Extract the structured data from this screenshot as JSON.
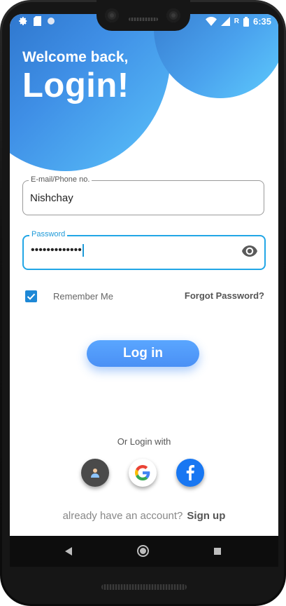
{
  "status_bar": {
    "time": "6:35",
    "icons_left": [
      "gear-icon",
      "sim-card-icon",
      "circle-icon"
    ],
    "icons_right": [
      "wifi-icon",
      "signal-icon",
      "battery-icon"
    ],
    "network_letter": "R"
  },
  "header": {
    "welcome": "Welcome back,",
    "title": "Login!"
  },
  "form": {
    "email": {
      "label": "E-mail/Phone no.",
      "value": "Nishchay"
    },
    "password": {
      "label": "Password",
      "value": "•••••••••••••"
    },
    "remember_me": {
      "label": "Remember Me",
      "checked": true
    },
    "forgot_password": "Forgot Password?",
    "login_button": "Log in"
  },
  "social": {
    "heading": "Or Login with",
    "providers": [
      "guest",
      "google",
      "facebook"
    ]
  },
  "footer": {
    "prompt": "already have an account?",
    "signup": "Sign up"
  },
  "colors": {
    "accent": "#4a90f5",
    "focus": "#22a6e6",
    "blob_dark": "#1f5fb5",
    "blob_light": "#5bc3fb",
    "facebook": "#1877f2"
  }
}
